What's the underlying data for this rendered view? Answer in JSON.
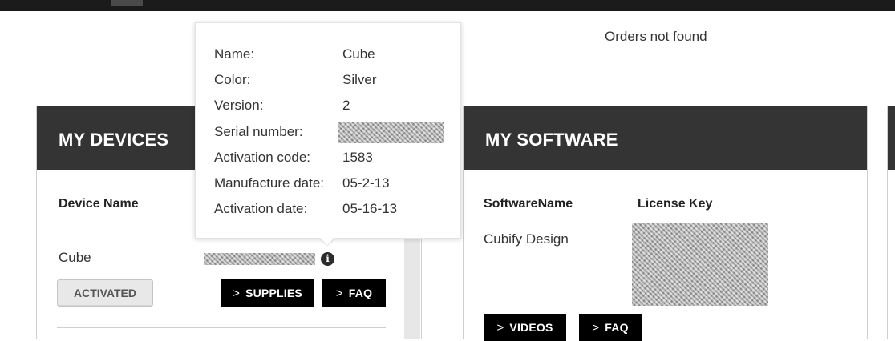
{
  "orders": {
    "empty_message": "Orders not found"
  },
  "devices": {
    "title": "MY DEVICES",
    "columns": {
      "name": "Device Name"
    },
    "rows": [
      {
        "name": "Cube",
        "status": "ACTIVATED",
        "supplies_label": "SUPPLIES",
        "faq_label": "FAQ"
      }
    ]
  },
  "software": {
    "title": "MY SOFTWARE",
    "columns": {
      "name": "SoftwareName",
      "license": "License Key"
    },
    "rows": [
      {
        "name": "Cubify Design",
        "videos_label": "VIDEOS",
        "faq_label": "FAQ"
      }
    ]
  },
  "tooltip": {
    "rows": [
      {
        "label": "Name:",
        "value": "Cube"
      },
      {
        "label": "Color:",
        "value": "Silver"
      },
      {
        "label": "Version:",
        "value": "2"
      },
      {
        "label": "Serial number:",
        "value": ""
      },
      {
        "label": "Activation code:",
        "value": "1583"
      },
      {
        "label": "Manufacture date:",
        "value": "05-2-13"
      },
      {
        "label": "Activation date:",
        "value": "05-16-13"
      }
    ]
  },
  "icons": {
    "chevron": "chevron-right-icon",
    "info": "info-icon"
  },
  "colors": {
    "header_bg": "#343434",
    "button_bg": "#000000",
    "pill_bg": "#e8e8e8"
  }
}
